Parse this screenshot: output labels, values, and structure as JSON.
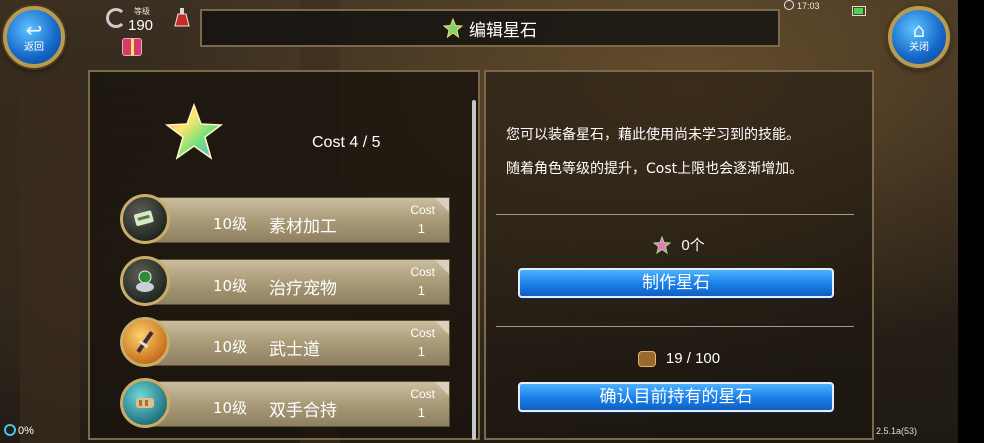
{
  "nav": {
    "back_label": "返回",
    "close_label": "关闭"
  },
  "player": {
    "level_label": "等级",
    "level": "190"
  },
  "title": "编辑星石",
  "status": {
    "time": "17:03"
  },
  "stone_panel": {
    "cost_summary": "Cost 4 / 5",
    "skills": [
      {
        "level": "10级",
        "name": "素材加工",
        "cost_label": "Cost",
        "cost": "1",
        "icon": "material-scroll-icon"
      },
      {
        "level": "10级",
        "name": "治疗宠物",
        "cost_label": "Cost",
        "cost": "1",
        "icon": "pet-heal-icon"
      },
      {
        "level": "10级",
        "name": "武士道",
        "cost_label": "Cost",
        "cost": "1",
        "icon": "katana-icon"
      },
      {
        "level": "10级",
        "name": "双手合持",
        "cost_label": "Cost",
        "cost": "1",
        "icon": "two-hand-icon"
      }
    ]
  },
  "info_panel": {
    "line1": "您可以装备星石，藉此使用尚未学习到的技能。",
    "line2": "随着角色等级的提升，Cost上限也会逐渐增加。",
    "stone_count": "0个",
    "craft_button": "制作星石",
    "material_count": "19 / 100",
    "confirm_button": "确认目前持有的星石"
  },
  "footer": {
    "progress": "0%",
    "version": "2.5.1a(53)"
  },
  "colors": {
    "button_blue": "#1a7ee6",
    "frame_gold": "#7b6a4a",
    "panel_dark": "#19140e"
  }
}
